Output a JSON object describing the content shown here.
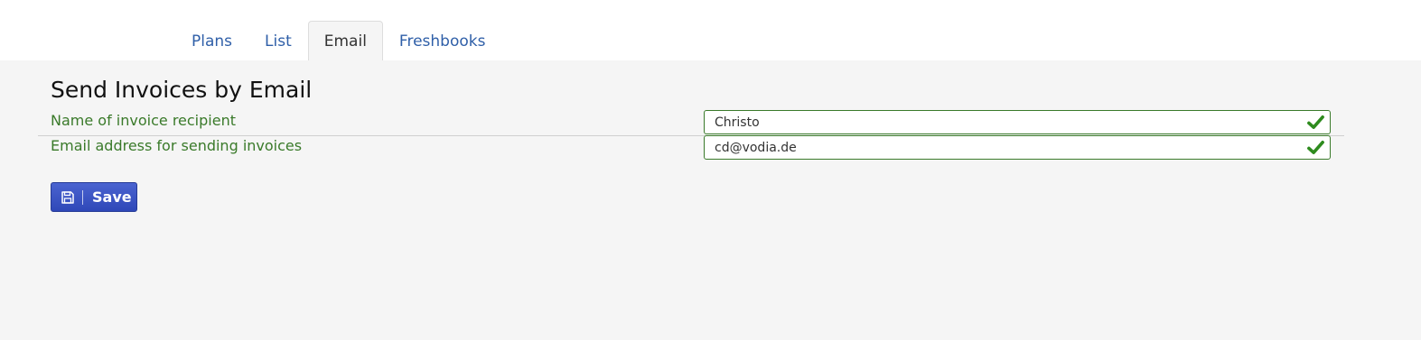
{
  "tabs": [
    {
      "label": "Plans",
      "active": false
    },
    {
      "label": "List",
      "active": false
    },
    {
      "label": "Email",
      "active": true
    },
    {
      "label": "Freshbooks",
      "active": false
    }
  ],
  "form": {
    "title": "Send Invoices by Email",
    "fields": [
      {
        "label": "Name of invoice recipient",
        "value": "Christo",
        "valid": true
      },
      {
        "label": "Email address for sending invoices",
        "value": "cd@vodia.de",
        "valid": true
      }
    ],
    "save_label": "Save"
  },
  "colors": {
    "tab_link": "#2f5fa8",
    "label_green": "#3a7a2a",
    "check_green": "#2e8b1e",
    "button_blue": "#3a52c2",
    "content_bg": "#f5f5f5"
  },
  "icons": {
    "valid": "checkmark-icon",
    "save": "floppy-disk-icon"
  }
}
